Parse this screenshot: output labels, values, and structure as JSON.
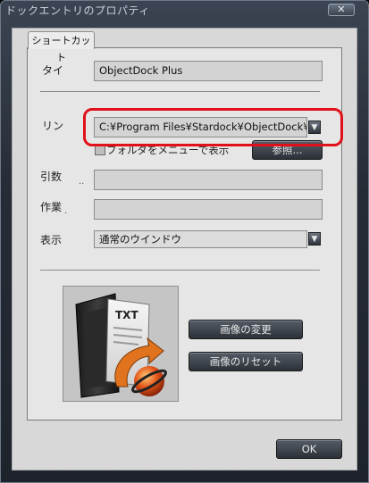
{
  "window": {
    "title": "ドックエントリのプロパティ",
    "close_glyph": "✕"
  },
  "tabs": [
    {
      "label": "ショートカット",
      "selected": true
    }
  ],
  "fields": {
    "title": {
      "label": "タイ",
      "value": "ObjectDock Plus"
    },
    "link": {
      "label": "リン",
      "value": "C:¥Program Files¥Stardock¥ObjectDock¥ObjectDock.exe"
    },
    "show_folder_as_menu": {
      "label": "フォルダをメニューで表示",
      "checked": false
    },
    "browse_button": {
      "label": "参照..."
    },
    "arguments": {
      "label": "引数",
      "suffix": "..",
      "value": ""
    },
    "working_dir": {
      "label": "作業",
      "suffix": ".",
      "value": ""
    },
    "display": {
      "label": "表示",
      "value": "通常のウインドウ"
    }
  },
  "buttons": {
    "change_image": "画像の変更",
    "reset_image": "画像のリセット",
    "ok": "OK"
  },
  "icons": {
    "combo_arrow": "▼",
    "image_preview": "text-file-with-orange-arrow-icon"
  },
  "colors": {
    "highlight": "#e2101a",
    "panel": "#e6e6e6",
    "window_frame": "#262c36"
  }
}
